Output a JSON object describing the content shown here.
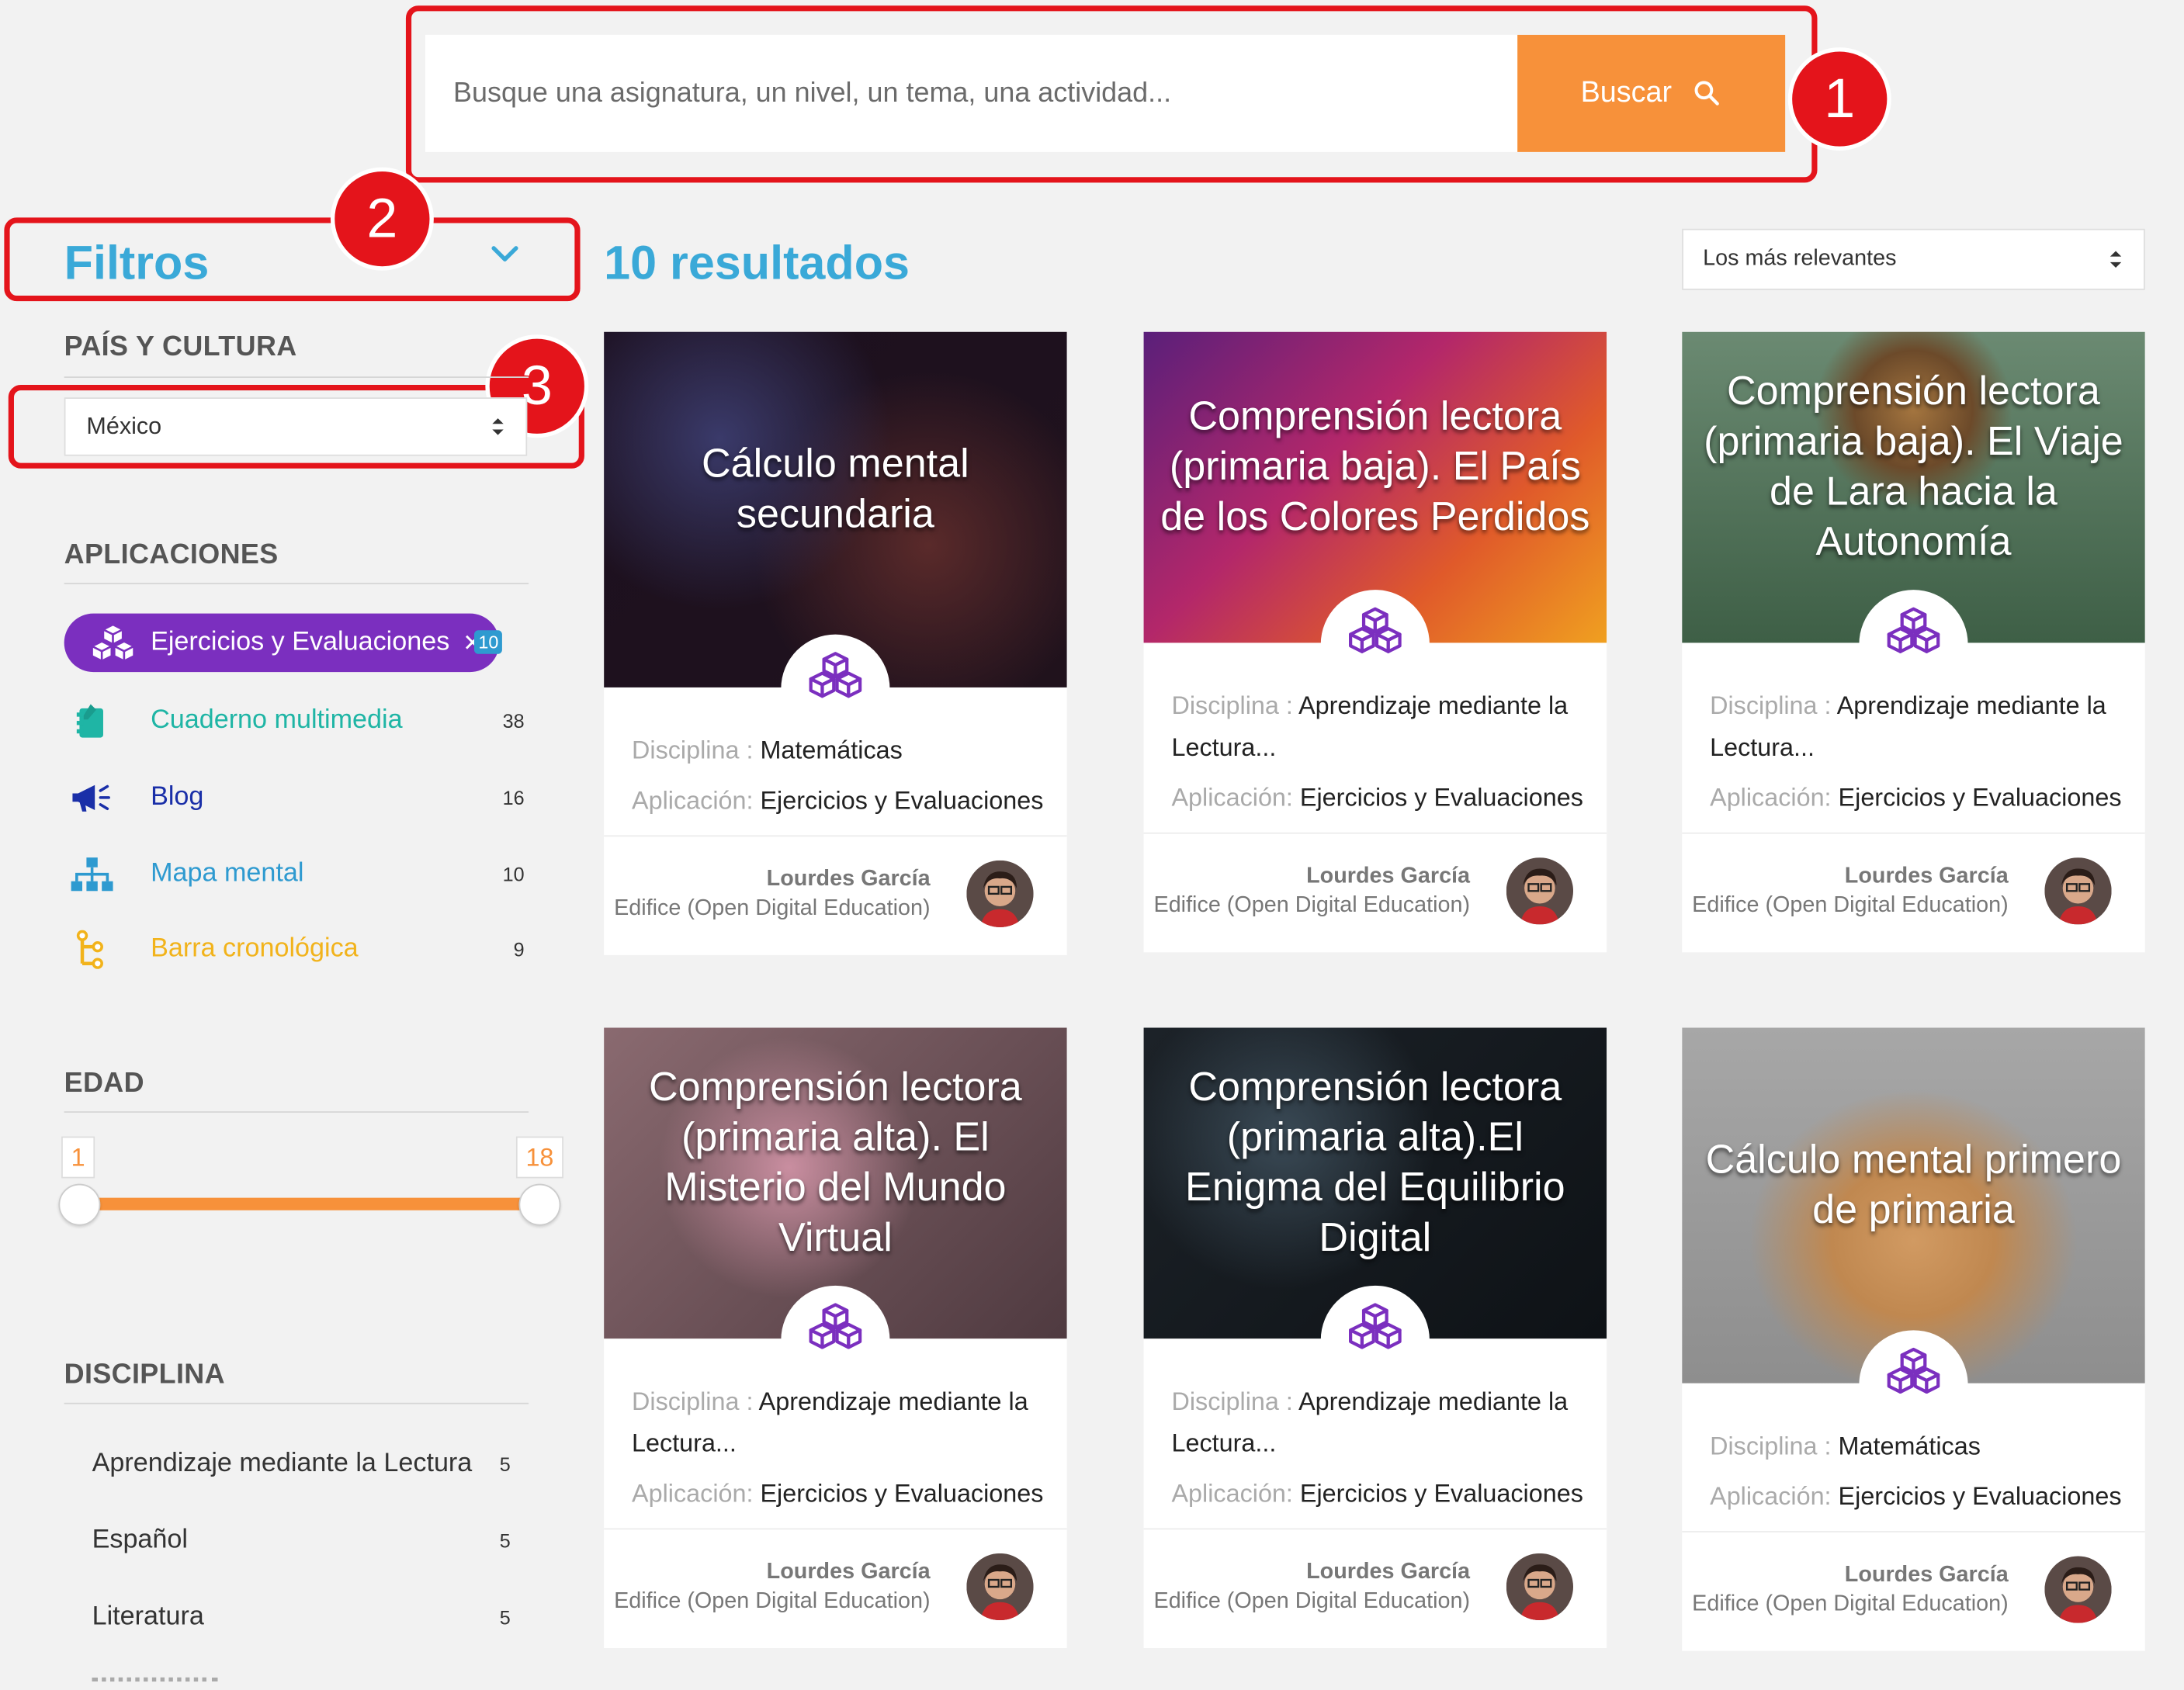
{
  "search": {
    "placeholder": "Busque una asignatura, un nivel, un tema, una actividad...",
    "button_label": "Buscar"
  },
  "annotations": [
    "1",
    "2",
    "3"
  ],
  "filters": {
    "title": "Filtros",
    "country_section": "PAÍS Y CULTURA",
    "country_selected": "México",
    "apps_section": "APLICACIONES",
    "apps": [
      {
        "label": "Ejercicios y Evaluaciones",
        "count": "10",
        "active": true,
        "icon": "cubes-icon",
        "color": "#7b2fbf"
      },
      {
        "label": "Cuaderno multimedia",
        "count": "38",
        "icon": "notebook-icon",
        "color": "#1fb5a5"
      },
      {
        "label": "Blog",
        "count": "16",
        "icon": "megaphone-icon",
        "color": "#1a2fa8"
      },
      {
        "label": "Mapa mental",
        "count": "10",
        "icon": "mindmap-icon",
        "color": "#2e9ad0"
      },
      {
        "label": "Barra cronológica",
        "count": "9",
        "icon": "timeline-icon",
        "color": "#f2b31b"
      }
    ],
    "age_section": "EDAD",
    "age_min": "1",
    "age_max": "18",
    "discipline_section": "DISCIPLINA",
    "disciplines": [
      {
        "label": "Aprendizaje mediante la Lectura",
        "count": "5"
      },
      {
        "label": "Español",
        "count": "5"
      },
      {
        "label": "Literatura",
        "count": "5"
      }
    ]
  },
  "results": {
    "count_label": "10 resultados",
    "sort_selected": "Los más relevantes"
  },
  "cards": [
    {
      "title": "Cálculo mental secundaria",
      "discipline_key": "Disciplina :",
      "discipline": "Matemáticas",
      "discipline_cont": "",
      "app_key": "Aplicación:",
      "app": "Ejercicios y Evaluaciones",
      "author": "Lourdes García",
      "org": "Edifice (Open Digital Education)"
    },
    {
      "title": "Comprensión lectora (primaria baja). El País de los Colores Perdidos",
      "discipline_key": "Disciplina :",
      "discipline": "Aprendizaje mediante la",
      "discipline_cont": "Lectura...",
      "app_key": "Aplicación:",
      "app": "Ejercicios y Evaluaciones",
      "author": "Lourdes García",
      "org": "Edifice (Open Digital Education)"
    },
    {
      "title": "Comprensión lectora (primaria baja). El Viaje de Lara hacia la Autonomía",
      "discipline_key": "Disciplina :",
      "discipline": "Aprendizaje mediante la",
      "discipline_cont": "Lectura...",
      "app_key": "Aplicación:",
      "app": "Ejercicios y Evaluaciones",
      "author": "Lourdes García",
      "org": "Edifice (Open Digital Education)"
    },
    {
      "title": "Comprensión lectora (primaria alta). El Misterio del Mundo Virtual",
      "discipline_key": "Disciplina :",
      "discipline": "Aprendizaje mediante la",
      "discipline_cont": "Lectura...",
      "app_key": "Aplicación:",
      "app": "Ejercicios y Evaluaciones",
      "author": "Lourdes García",
      "org": "Edifice (Open Digital Education)"
    },
    {
      "title": "Comprensión lectora (primaria alta).El Enigma del Equilibrio Digital",
      "discipline_key": "Disciplina :",
      "discipline": "Aprendizaje mediante la",
      "discipline_cont": "Lectura...",
      "app_key": "Aplicación:",
      "app": "Ejercicios y Evaluaciones",
      "author": "Lourdes García",
      "org": "Edifice (Open Digital Education)"
    },
    {
      "title": "Cálculo mental primero de primaria",
      "discipline_key": "Disciplina :",
      "discipline": "Matemáticas",
      "discipline_cont": "",
      "app_key": "Aplicación:",
      "app": "Ejercicios y Evaluaciones",
      "author": "Lourdes García",
      "org": "Edifice (Open Digital Education)"
    }
  ],
  "colors": {
    "accent_orange": "#f7913a",
    "title_blue": "#3aa9d8",
    "purple": "#7b2fbf",
    "annotation_red": "#e4141b"
  }
}
